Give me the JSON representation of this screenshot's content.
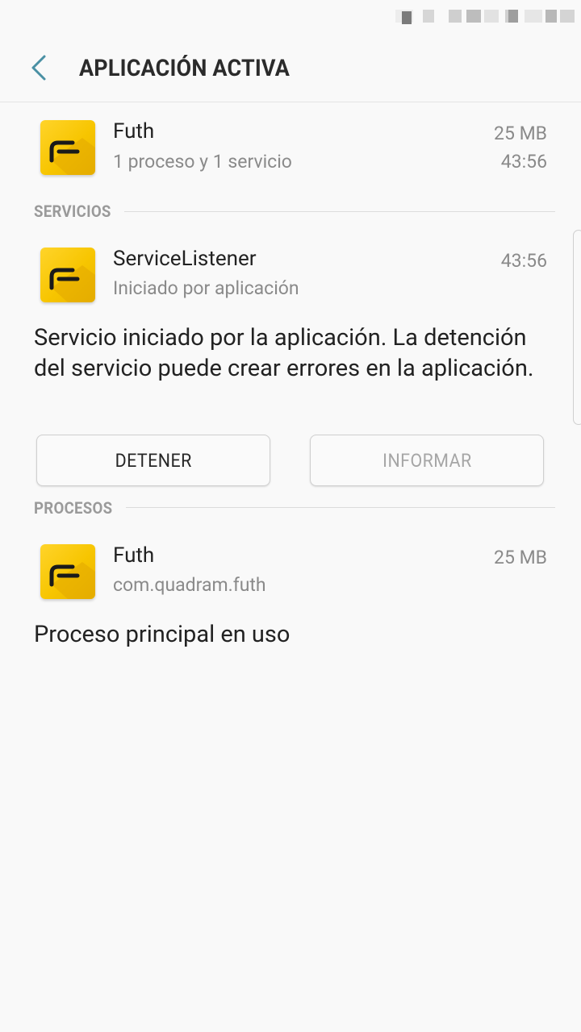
{
  "header": {
    "title": "APLICACIÓN ACTIVA"
  },
  "app": {
    "name": "Futh",
    "summary": "1 proceso y 1 servicio",
    "memory": "25 MB",
    "time": "43:56"
  },
  "services": {
    "section_label": "SERVICIOS",
    "item": {
      "name": "ServiceListener",
      "status": "Iniciado por aplicación",
      "time": "43:56"
    },
    "description": "Servicio iniciado por la aplicación. La detención del servicio puede crear errores en la aplicación.",
    "stop_label": "DETENER",
    "report_label": "INFORMAR"
  },
  "processes": {
    "section_label": "PROCESOS",
    "item": {
      "name": "Futh",
      "package": "com.quadram.futh",
      "memory": "25 MB"
    },
    "description": "Proceso principal en uso"
  },
  "colors": {
    "accent": "#4a90a4",
    "icon_yellow": "#f7c500"
  }
}
